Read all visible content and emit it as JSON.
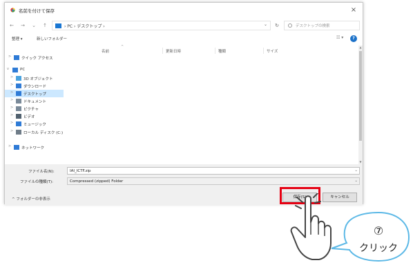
{
  "window": {
    "title": "名前を付けて保存",
    "close_glyph": "×"
  },
  "nav_buttons": {
    "back": "←",
    "forward": "→",
    "dropdown": "⌄",
    "up": "↑"
  },
  "address": {
    "crumbs": "›  PC  ›  デスクトップ  ›",
    "dropdown_glyph": "⌄",
    "refresh_glyph": "↻",
    "search_placeholder": "デスクトップの検索"
  },
  "toolbar": {
    "organize": "整理 ▾",
    "new_folder": "新しいフォルダー",
    "view_glyph": "☷ ▾",
    "help_glyph": "?"
  },
  "nav_pane": [
    {
      "label": "クイック アクセス",
      "icon": "star-icon",
      "chevron": ">",
      "color": "#2f7bd6"
    },
    {
      "label": "PC",
      "icon": "pc-icon",
      "chevron": "v",
      "color": "#2f7bd6"
    },
    {
      "label": "3D オブジェクト",
      "icon": "cube-icon",
      "chevron": ">",
      "color": "#4aa3df"
    },
    {
      "label": "ダウンロード",
      "icon": "download-icon",
      "chevron": ">",
      "color": "#2f7bd6"
    },
    {
      "label": "デスクトップ",
      "icon": "desktop-icon",
      "chevron": ">",
      "color": "#2f7bd6"
    },
    {
      "label": "ドキュメント",
      "icon": "document-icon",
      "chevron": ">",
      "color": "#7a8a99"
    },
    {
      "label": "ピクチャ",
      "icon": "picture-icon",
      "chevron": ">",
      "color": "#7a8a99"
    },
    {
      "label": "ビデオ",
      "icon": "video-icon",
      "chevron": ">",
      "color": "#51616f"
    },
    {
      "label": "ミュージック",
      "icon": "music-icon",
      "chevron": ">",
      "color": "#2f7bd6"
    },
    {
      "label": "ローカル ディスク (C:)",
      "icon": "drive-icon",
      "chevron": ">",
      "color": "#6f7c88"
    },
    {
      "label": "ネットワーク",
      "icon": "network-icon",
      "chevron": ">",
      "color": "#2f7bd6"
    }
  ],
  "columns": {
    "name": "名前",
    "modified": "更新日時",
    "type": "種類",
    "size": "サイズ",
    "sort_glyph": "^"
  },
  "scrollbar": {
    "up": "▲",
    "down": "▼"
  },
  "save_form": {
    "filename_label": "ファイル名(N):",
    "filename_value": "IAI_ICTF.zip",
    "filetype_label": "ファイルの種類(T):",
    "filetype_value": "Compressed (zipped) Folder",
    "dropdown_glyph": "⌄"
  },
  "footer": {
    "hide_folders": "^  フォルダーの非表示",
    "save_button": "保存(S)",
    "cancel_button": "キャンセル"
  },
  "annotation": {
    "step_number": "⑦",
    "step_label": "クリック"
  },
  "colors": {
    "highlight": "#e60012",
    "selection": "#cce8ff",
    "accent": "#1976d2",
    "callout_border": "#5bb8e6"
  }
}
